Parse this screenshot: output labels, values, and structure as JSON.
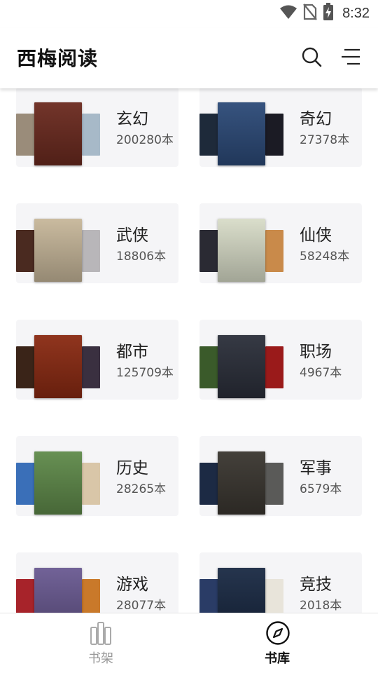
{
  "status_bar": {
    "time": "8:32",
    "icons": [
      "wifi-icon",
      "no-sim-icon",
      "battery-charging-icon"
    ]
  },
  "app_bar": {
    "title": "西梅阅读",
    "actions": [
      "search-icon",
      "menu-icon"
    ]
  },
  "categories": [
    {
      "name": "玄幻",
      "count": "200280本",
      "cover_colors": [
        "#9a8c7a",
        "#6b2a1f",
        "#a7b9c8"
      ]
    },
    {
      "name": "奇幻",
      "count": "27378本",
      "cover_colors": [
        "#1e2a3a",
        "#2c4a78",
        "#1b1b24"
      ]
    },
    {
      "name": "武侠",
      "count": "18806本",
      "cover_colors": [
        "#4a2a20",
        "#c7b79a",
        "#b8b6b9"
      ]
    },
    {
      "name": "仙侠",
      "count": "58248本",
      "cover_colors": [
        "#2a2a33",
        "#d8dcc8",
        "#c98a4a"
      ]
    },
    {
      "name": "都市",
      "count": "125709本",
      "cover_colors": [
        "#3a2418",
        "#8a2a12",
        "#3a3040"
      ]
    },
    {
      "name": "职场",
      "count": "4967本",
      "cover_colors": [
        "#3a5a2a",
        "#2b2f3a",
        "#9a1a1a"
      ]
    },
    {
      "name": "历史",
      "count": "28265本",
      "cover_colors": [
        "#3a6fb8",
        "#5f8a4a",
        "#d9c6a8"
      ]
    },
    {
      "name": "军事",
      "count": "6579本",
      "cover_colors": [
        "#1c2a44",
        "#3a3630",
        "#5a5a58"
      ]
    },
    {
      "name": "游戏",
      "count": "28077本",
      "cover_colors": [
        "#a7232a",
        "#6a5a92",
        "#c9792a"
      ]
    },
    {
      "name": "竞技",
      "count": "2018本",
      "cover_colors": [
        "#2a3c66",
        "#1a2a44",
        "#e8e4da"
      ]
    }
  ],
  "bottom_nav": {
    "items": [
      {
        "label": "书架",
        "icon": "bookshelf-icon",
        "active": false
      },
      {
        "label": "书库",
        "icon": "compass-icon",
        "active": true
      }
    ]
  },
  "colors": {
    "card_bg": "#f5f5f7",
    "active_nav": "#111111",
    "inactive_nav": "#999999"
  }
}
